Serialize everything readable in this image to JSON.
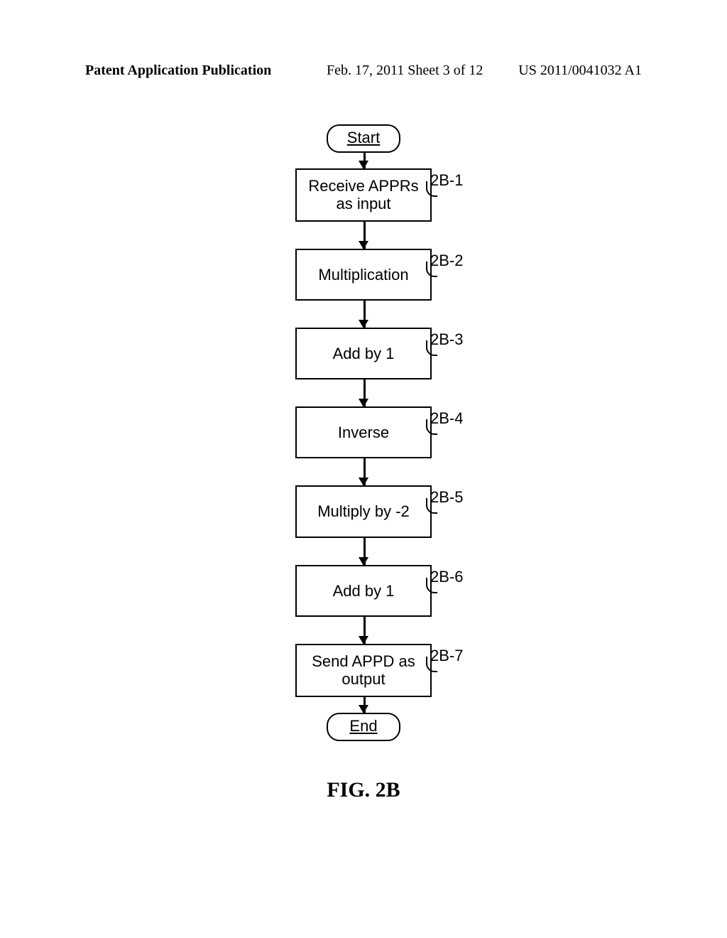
{
  "header": {
    "left": "Patent Application Publication",
    "center": "Feb. 17, 2011  Sheet 3 of 12",
    "right": "US 2011/0041032 A1"
  },
  "flow": {
    "start": "Start",
    "end": "End",
    "steps": [
      {
        "text": "Receive APPRs as input",
        "label": "2B-1",
        "lines": 2
      },
      {
        "text": "Multiplication",
        "label": "2B-2",
        "lines": 1
      },
      {
        "text": "Add by 1",
        "label": "2B-3",
        "lines": 1
      },
      {
        "text": "Inverse",
        "label": "2B-4",
        "lines": 1
      },
      {
        "text": "Multiply by -2",
        "label": "2B-5",
        "lines": 1
      },
      {
        "text": "Add by 1",
        "label": "2B-6",
        "lines": 1
      },
      {
        "text": "Send APPD as output",
        "label": "2B-7",
        "lines": 2
      }
    ]
  },
  "caption": "FIG. 2B"
}
